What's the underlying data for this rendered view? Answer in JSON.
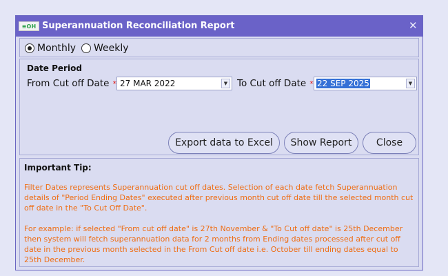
{
  "dialog": {
    "title": "Superannuation Reconciliation Report",
    "logo_text_green": "≡OH",
    "close_glyph": "✕"
  },
  "frequency": {
    "options": [
      {
        "label": "Monthly",
        "selected": true
      },
      {
        "label": "Weekly",
        "selected": false
      }
    ]
  },
  "date_period": {
    "heading": "Date Period",
    "from_label": "From Cut off Date",
    "from_value": "27 MAR 2022",
    "to_label": "To Cut off Date",
    "to_value": "22 SEP 2025",
    "required_mark": "*"
  },
  "buttons": {
    "export": "Export data to Excel",
    "show_report": "Show Report",
    "close": "Close"
  },
  "tip": {
    "heading": "Important Tip:",
    "paragraph1": "Filter Dates represents Superannuation cut off dates. Selection of each date fetch Superannuation details of \"Period Ending Dates\" executed after previous month cut off date till the selected month cut off date in the \"To Cut Off Date\".",
    "paragraph2": "For example: if selected \"From cut off date\" is 27th November & \"To Cut off date\" is 25th December then system will fetch superannuation data for 2 months from Ending dates processed after cut off date in the previous month selected in the From Cut off date i.e. October till ending dates equal to 25th December."
  },
  "colors": {
    "titlebar": "#6a62c8",
    "dialog_bg": "#dadcf1",
    "tip_text": "#ef6d13",
    "required": "#e0201c",
    "selection": "#3470d6"
  }
}
